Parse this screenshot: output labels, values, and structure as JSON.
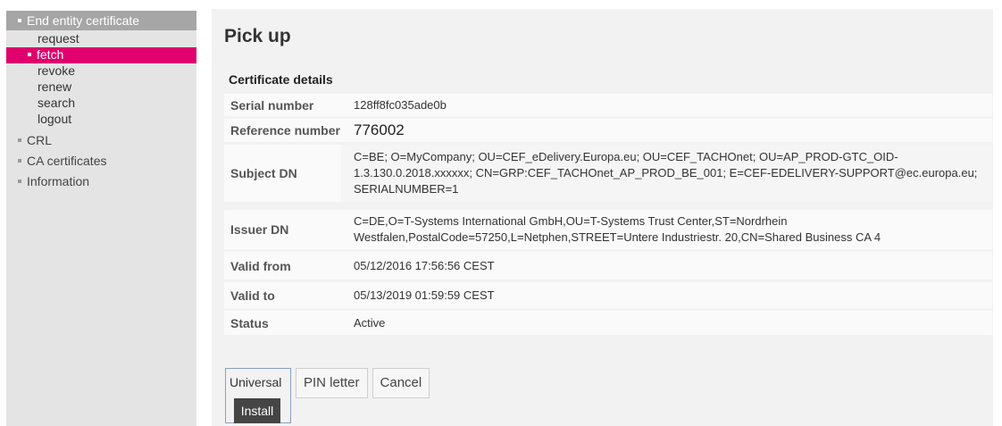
{
  "sidebar": {
    "section_end_entity": "End entity certificate",
    "sub_items": [
      {
        "label": "request",
        "active": false
      },
      {
        "label": "fetch",
        "active": true
      },
      {
        "label": "revoke",
        "active": false
      },
      {
        "label": "renew",
        "active": false
      },
      {
        "label": "search",
        "active": false
      },
      {
        "label": "logout",
        "active": false
      }
    ],
    "main_items": [
      {
        "label": "CRL"
      },
      {
        "label": "CA certificates"
      },
      {
        "label": "Information"
      }
    ]
  },
  "main": {
    "title": "Pick up",
    "section_title": "Certificate details",
    "details": {
      "serial": {
        "label": "Serial number",
        "value": "128ff8fc035ade0b"
      },
      "reference": {
        "label": "Reference number",
        "value": "776002"
      },
      "subject": {
        "label": "Subject DN",
        "value": "C=BE; O=MyCompany; OU=CEF_eDelivery.Europa.eu; OU=CEF_TACHOnet; OU=AP_PROD-GTC_OID-1.3.130.0.2018.xxxxxx; CN=GRP:CEF_TACHOnet_AP_PROD_BE_001; E=CEF-EDELIVERY-SUPPORT@ec.europa.eu; SERIALNUMBER=1"
      },
      "issuer": {
        "label": "Issuer DN",
        "value": "C=DE,O=T-Systems International GmbH,OU=T-Systems Trust Center,ST=Nordrhein Westfalen,PostalCode=57250,L=Netphen,STREET=Untere Industriestr. 20,CN=Shared Business CA 4"
      },
      "valid_from": {
        "label": "Valid from",
        "value": "05/12/2016 17:56:56 CEST"
      },
      "valid_to": {
        "label": "Valid to",
        "value": "05/13/2019 01:59:59 CEST"
      },
      "status": {
        "label": "Status",
        "value": "Active"
      }
    },
    "buttons": {
      "universal": "Universal",
      "install": "Install",
      "pin_letter": "PIN letter",
      "cancel": "Cancel"
    }
  },
  "colors": {
    "accent": "#e0006d",
    "sidebar_bg": "#e4e4e4",
    "sidebar_header": "#a6a6a6",
    "content_bg": "#f2f2f2"
  }
}
